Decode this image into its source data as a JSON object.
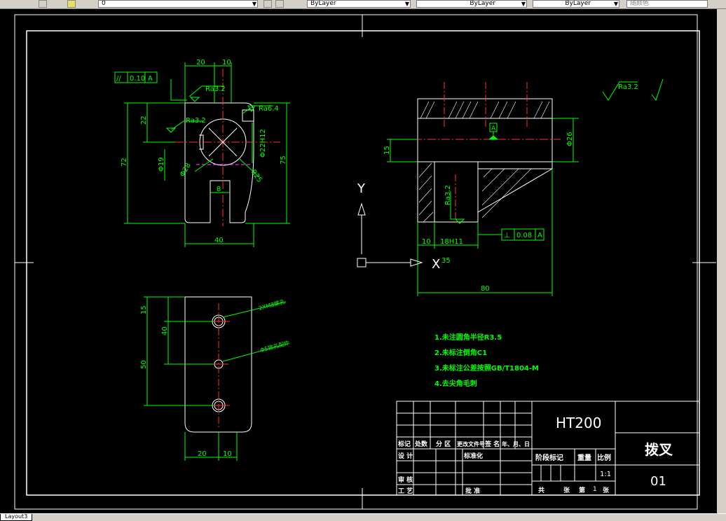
{
  "toolbar": {
    "layer_value": "0",
    "color_value": "ByLayer",
    "linetype_value": "ByLayer",
    "lineweight_value": "ByLayer",
    "plotstyle_value": "随颜色"
  },
  "drawing": {
    "part_name": "拨叉",
    "material": "HT200",
    "drawing_no": "01",
    "scale": "1:1",
    "sheet_total_label": "共",
    "sheet_label": "张",
    "sheet_no_label": "第",
    "sheet_no": "1",
    "sheet_suffix": "张",
    "roughness_general": "Ra3.2",
    "notes": [
      "1.未注圆角半径R3.5",
      "2.未标注倒角C1",
      "3.未标注公差按照GB/T1804-M",
      "4.去尖角毛刺"
    ],
    "title_block": {
      "row1": [
        "标记",
        "处数",
        "分 区",
        "更改文件号",
        "签 名",
        "年、月、日"
      ],
      "design": "设 计",
      "standardize": "标准化",
      "stage_mark": "阶段标记",
      "weight": "重量",
      "ratio": "比例",
      "audit": "审 核",
      "process": "工 艺",
      "approve": "批 准"
    },
    "front_view": {
      "dim_20_top": "20",
      "dim_10_top": "10",
      "dim_22": "22",
      "dim_72": "72",
      "dim_75": "75",
      "dim_40": "40",
      "dim_8": "8",
      "dim_phi19": "Φ19",
      "dim_phi28": "Φ28",
      "dim_phi22": "Φ22H12",
      "dim_r25": "R25",
      "ra_32_top": "Ra3.2",
      "ra_64": "Ra6.4",
      "ra_32_left": "Ra3.2",
      "parallel_value": "0.10",
      "parallel_datum": "A",
      "parallel_symbol": "//"
    },
    "side_view": {
      "dim_15": "15",
      "dim_26": "Φ26",
      "dim_10": "10",
      "dim_18": "18H11",
      "dim_35": "35",
      "dim_80": "80",
      "ra_32": "Ra3.2",
      "perp_symbol": "⊥",
      "perp_value": "0.08",
      "perp_datum": "A",
      "datum_label": "A"
    },
    "bottom_view": {
      "dim_15": "15",
      "dim_40": "40",
      "dim_50": "50",
      "dim_20": "20",
      "dim_10": "10",
      "note_holes": "2XM8螺孔",
      "note_pin": "Φ5锥孔配作"
    },
    "ucs": {
      "x_label": "X",
      "y_label": "Y"
    }
  },
  "statusbar": {
    "tab": "Layout3"
  }
}
